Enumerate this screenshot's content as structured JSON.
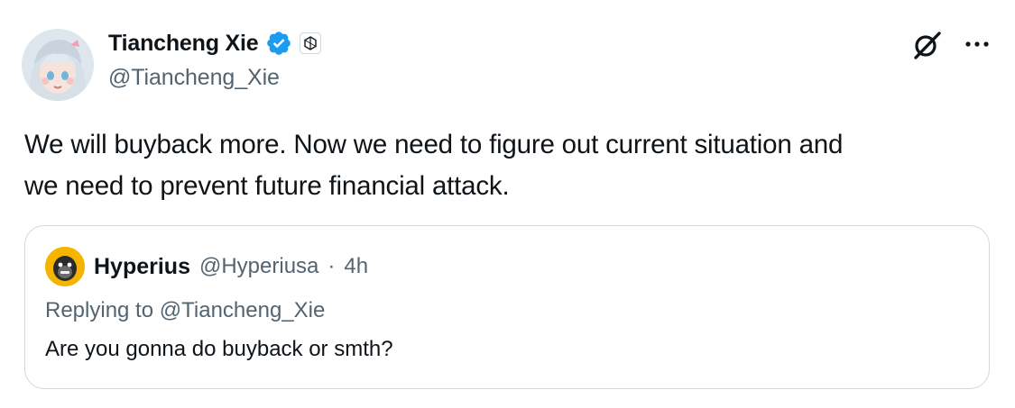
{
  "author": {
    "display_name": "Tiancheng Xie",
    "handle": "@Tiancheng_Xie",
    "verified": true,
    "badge_icon": "affiliate-badge-icon"
  },
  "header_actions": {
    "grok_icon": "grok-icon",
    "more_icon": "more-icon"
  },
  "tweet": {
    "text": "We will buyback more. Now we need to figure out current situation and\nwe need to prevent future financial attack."
  },
  "quoted": {
    "display_name": "Hyperius",
    "handle": "@Hyperiusa",
    "separator": "·",
    "time": "4h",
    "reply_prefix": "Replying to",
    "reply_handle": "@Tiancheng_Xie",
    "text": "Are you gonna do buyback or smth?"
  },
  "colors": {
    "text": "#0f1419",
    "secondary": "#536471",
    "verified_blue": "#1d9bf0",
    "border": "#cfd9de"
  }
}
